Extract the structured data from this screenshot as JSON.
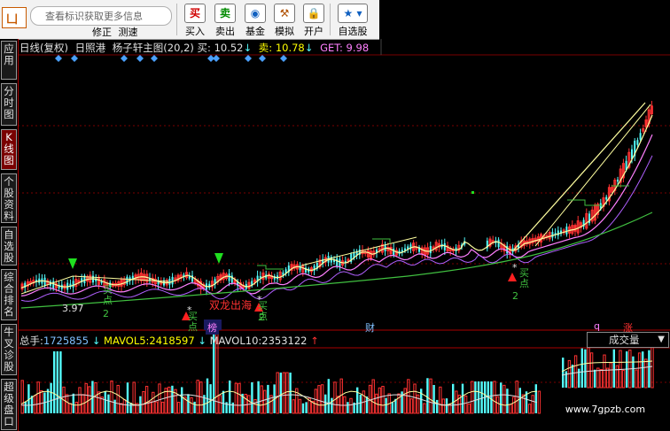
{
  "toolbar": {
    "search_placeholder": "查看标识获取更多信息",
    "buttons": [
      {
        "label": "买入",
        "icon": "买",
        "color": "#d00000"
      },
      {
        "label": "卖出",
        "icon": "卖",
        "color": "#008a00"
      },
      {
        "label": "基金",
        "icon": "◉",
        "color": "#1060c0"
      },
      {
        "label": "模拟",
        "icon": "⚒",
        "color": "#b05000"
      },
      {
        "label": "开户",
        "icon": "🔒",
        "color": "#c08000"
      },
      {
        "label": "自选股",
        "icon": "★",
        "color": "#1060c0"
      }
    ],
    "hidden_labels": [
      "修正",
      "测速"
    ]
  },
  "side_tabs": [
    {
      "label": "应用",
      "active": false
    },
    {
      "label": "分时图",
      "active": false
    },
    {
      "label": "K线图",
      "active": true
    },
    {
      "label": "个股资料",
      "active": false
    },
    {
      "label": "自选股",
      "active": false
    },
    {
      "label": "综合排名",
      "active": false
    },
    {
      "label": "牛叉诊股",
      "active": false
    },
    {
      "label": "超级盘口",
      "active": false
    }
  ],
  "chart_header": {
    "period": "日线(复权)",
    "stock": "日照港",
    "indicator": "杨子轩主图(20,2)",
    "buy_label": "买:",
    "buy_value": "10.52",
    "sell_label": "卖:",
    "sell_value": "10.78",
    "get_label": "GET:",
    "get_value": "9.98"
  },
  "annotations": {
    "low_price": "3.97",
    "buy_point_label": "买点",
    "buy_point_num": "2",
    "double_dragon": "双龙出海",
    "bang": "榜",
    "cai": "财",
    "q": "q",
    "zhang": "涨",
    "star": "*"
  },
  "volume_header": {
    "total_label": "总手:",
    "total_value": "1725855",
    "mavol5_label": "MAVOL5:",
    "mavol5_value": "2418597",
    "mavol10_label": "MAVOL10:",
    "mavol10_value": "2353122",
    "dropdown_label": "成交量"
  },
  "watermark": "www.7gpzb.com",
  "colors": {
    "up": "#ff3232",
    "down": "#54fcfc",
    "ma_yellow": "#ffffa0",
    "ma_pink": "#ff80ff",
    "ma_green": "#40c040",
    "ma_purple": "#b060ff",
    "label_white": "#e0e0e0",
    "label_yellow": "#ffff00",
    "label_blue": "#80c0ff"
  }
}
